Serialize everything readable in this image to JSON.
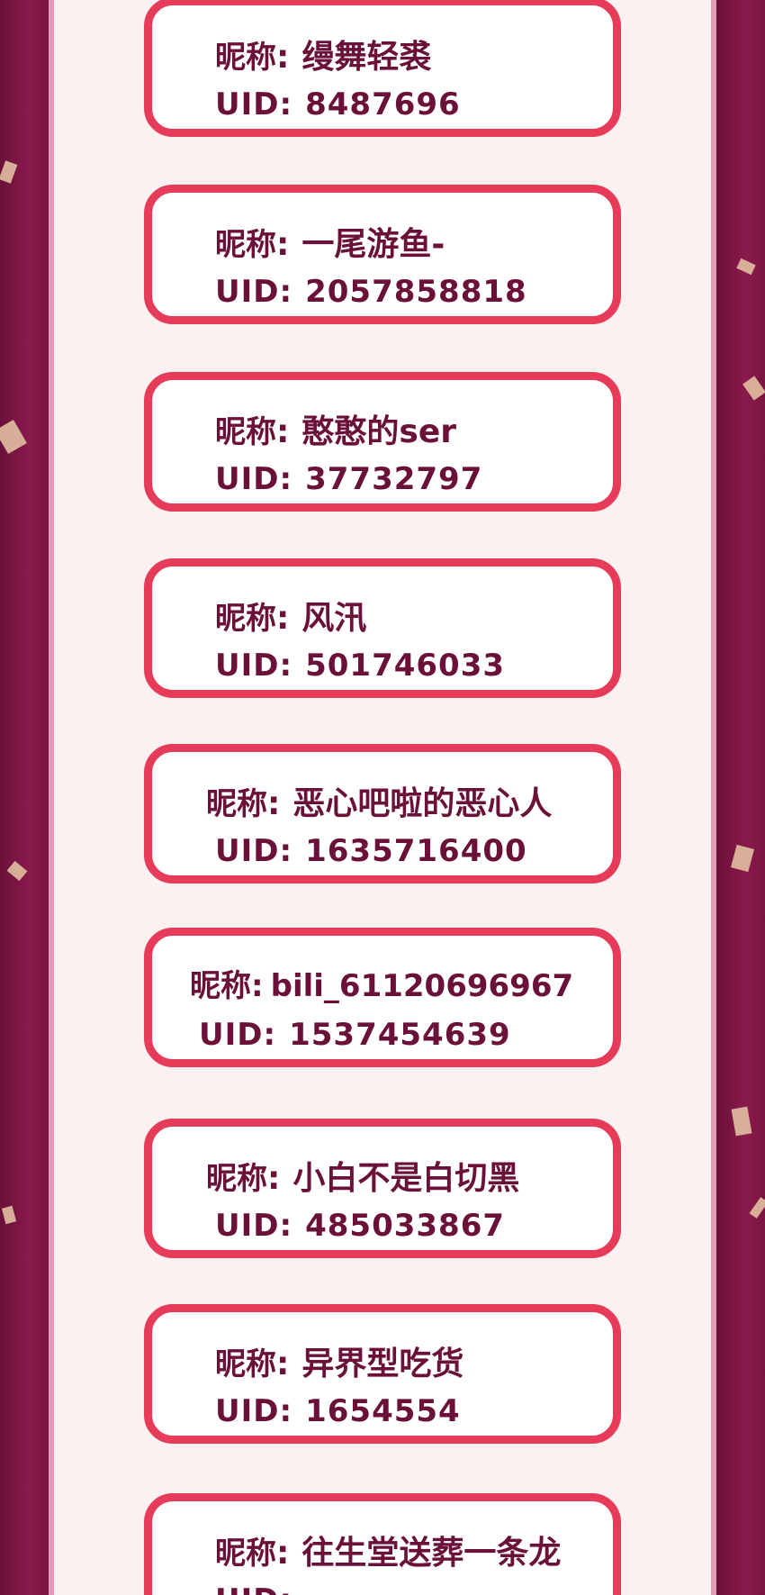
{
  "labels": {
    "nickname": "昵称",
    "uid": "UID"
  },
  "entries": [
    {
      "nickname": "缦舞轻裘",
      "uid": "8487696"
    },
    {
      "nickname": "一尾游鱼-",
      "uid": "2057858818"
    },
    {
      "nickname": "憨憨的ser",
      "uid": "37732797"
    },
    {
      "nickname": "风汛",
      "uid": "501746033"
    },
    {
      "nickname": "恶心吧啦的恶心人",
      "uid": "1635716400"
    },
    {
      "nickname": "bili_61120696967",
      "uid": "1537454639"
    },
    {
      "nickname": "小白不是白切黑",
      "uid": "485033867"
    },
    {
      "nickname": "异界型吃货",
      "uid": "1654554"
    },
    {
      "nickname": "往生堂送葬一条龙",
      "uid": ""
    }
  ],
  "colors": {
    "frame": "#7e1442",
    "panel": "#fbf1f1",
    "card_border": "#e63b59",
    "text": "#6a1039"
  }
}
